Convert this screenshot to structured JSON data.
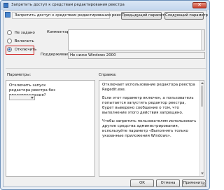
{
  "window": {
    "title": "Запретить доступ к средствам редактирования реестра",
    "close_glyph": "✕"
  },
  "top": {
    "policy_name": "Запретить доступ к средствам редактирования реестра",
    "prev_button": "Предыдущий параметр",
    "next_button": "Следующий параметр"
  },
  "state": {
    "options": [
      {
        "label": "Не задано",
        "checked": false
      },
      {
        "label": "Включить",
        "checked": false
      },
      {
        "label": "Отключить",
        "checked": true
      }
    ]
  },
  "comment": {
    "label": "Комментарий:",
    "value": ""
  },
  "supported": {
    "label": "Поддерживается:",
    "value": "Не ниже Windows 2000"
  },
  "options_panel": {
    "label": "Параметры:",
    "text": "Отключить запуск редактора реестра без предупреждения?",
    "dropdown_value": ""
  },
  "help_panel": {
    "label": "Справка:",
    "paragraphs": [
      "Отключает использование редактора реестра Regedit.exe.",
      "Если этот параметр включен, а пользователь попытается запустить редактор реестра, будет выведено сообщение о том, что выполнение этого действия запрещено.",
      "Чтобы запретить пользователям использовать другие средства администрирования, используйте параметр «Выполнять только указанные приложения Windows»."
    ]
  },
  "footer": {
    "ok": "ОК",
    "cancel": "Отмена",
    "apply": "Применить"
  },
  "colors": {
    "highlight": "#d02020",
    "radio_selected": "#2b6cc4"
  }
}
